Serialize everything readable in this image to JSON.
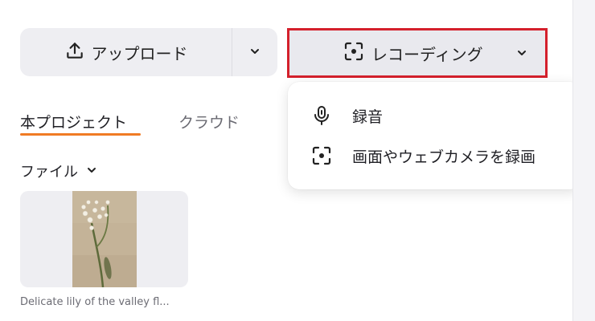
{
  "upload": {
    "label": "アップロード"
  },
  "recording": {
    "label": "レコーディング"
  },
  "tabs": [
    {
      "label": "本プロジェクト",
      "active": true
    },
    {
      "label": "クラウド",
      "active": false
    }
  ],
  "files": {
    "label": "ファイル"
  },
  "media": [
    {
      "name": "Delicate lily of the valley fl..."
    }
  ],
  "recording_menu": {
    "items": [
      {
        "label": "録音",
        "icon": "microphone-icon"
      },
      {
        "label": "画面やウェブカメラを録画",
        "icon": "screen-record-icon"
      }
    ]
  },
  "colors": {
    "accent": "#f07b24",
    "highlight_border": "#d4202c"
  }
}
